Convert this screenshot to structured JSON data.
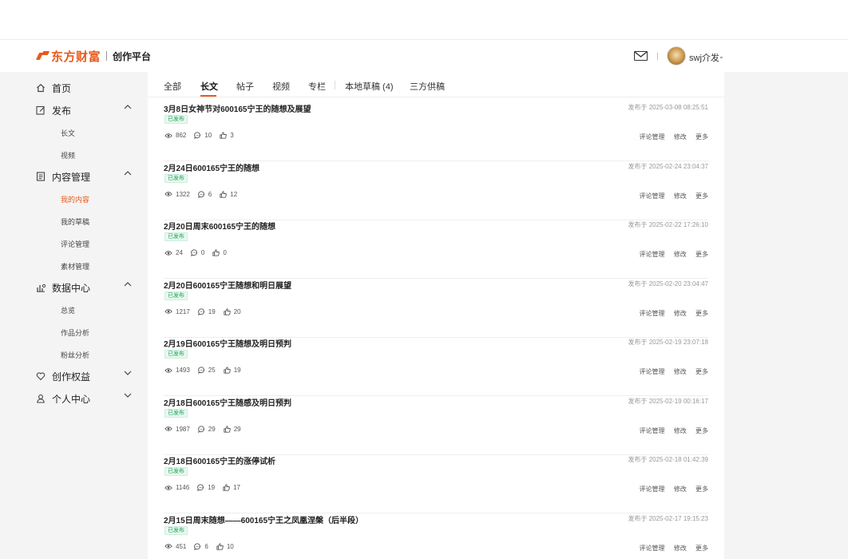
{
  "header": {
    "logo_text": "东方财富",
    "platform": "创作平台",
    "username": "swj介发"
  },
  "sidebar": {
    "home": "首页",
    "publish": {
      "label": "发布",
      "children": [
        "长文",
        "视频"
      ]
    },
    "content": {
      "label": "内容管理",
      "children": [
        "我的内容",
        "我的草稿",
        "评论管理",
        "素材管理"
      ],
      "active": "我的内容"
    },
    "data": {
      "label": "数据中心",
      "children": [
        "总览",
        "作品分析",
        "粉丝分析"
      ]
    },
    "benefits": "创作权益",
    "personal": "个人中心"
  },
  "tabs": [
    "全部",
    "长文",
    "帖子",
    "视频",
    "专栏",
    "本地草稿 (4)",
    "三方供稿"
  ],
  "active_tab": "长文",
  "articles": [
    {
      "title": "3月8日女神节对600165宁王的随想及展望",
      "date": "发布于 2025-03-08 08:25:51",
      "status": "已发布",
      "views": "862",
      "comments": "10",
      "likes": "3"
    },
    {
      "title": "2月24日600165宁王的随想",
      "date": "发布于 2025-02-24 23:04:37",
      "status": "已发布",
      "views": "1322",
      "comments": "6",
      "likes": "12"
    },
    {
      "title": "2月20日周末600165宁王的随想",
      "date": "发布于 2025-02-22 17:26:10",
      "status": "已发布",
      "views": "24",
      "comments": "0",
      "likes": "0"
    },
    {
      "title": "2月20日600165宁王随想和明日展望",
      "date": "发布于 2025-02-20 23:04:47",
      "status": "已发布",
      "views": "1217",
      "comments": "19",
      "likes": "20"
    },
    {
      "title": "2月19日600165宁王随想及明日预判",
      "date": "发布于 2025-02-19 23:07:18",
      "status": "已发布",
      "views": "1493",
      "comments": "25",
      "likes": "19"
    },
    {
      "title": "2月18日600165宁王随感及明日预判",
      "date": "发布于 2025-02-19 00:16:17",
      "status": "已发布",
      "views": "1987",
      "comments": "29",
      "likes": "29"
    },
    {
      "title": "2月18日600165宁王的涨停试析",
      "date": "发布于 2025-02-18 01:42:39",
      "status": "已发布",
      "views": "1146",
      "comments": "19",
      "likes": "17"
    },
    {
      "title": "2月15日周末随想——600165宁王之凤凰涅槃（后半段）",
      "date": "发布于 2025-02-17 19:15:23",
      "status": "已发布",
      "views": "451",
      "comments": "6",
      "likes": "10"
    }
  ],
  "actions": {
    "comments": "评论管理",
    "edit": "修改",
    "more": "更多"
  }
}
